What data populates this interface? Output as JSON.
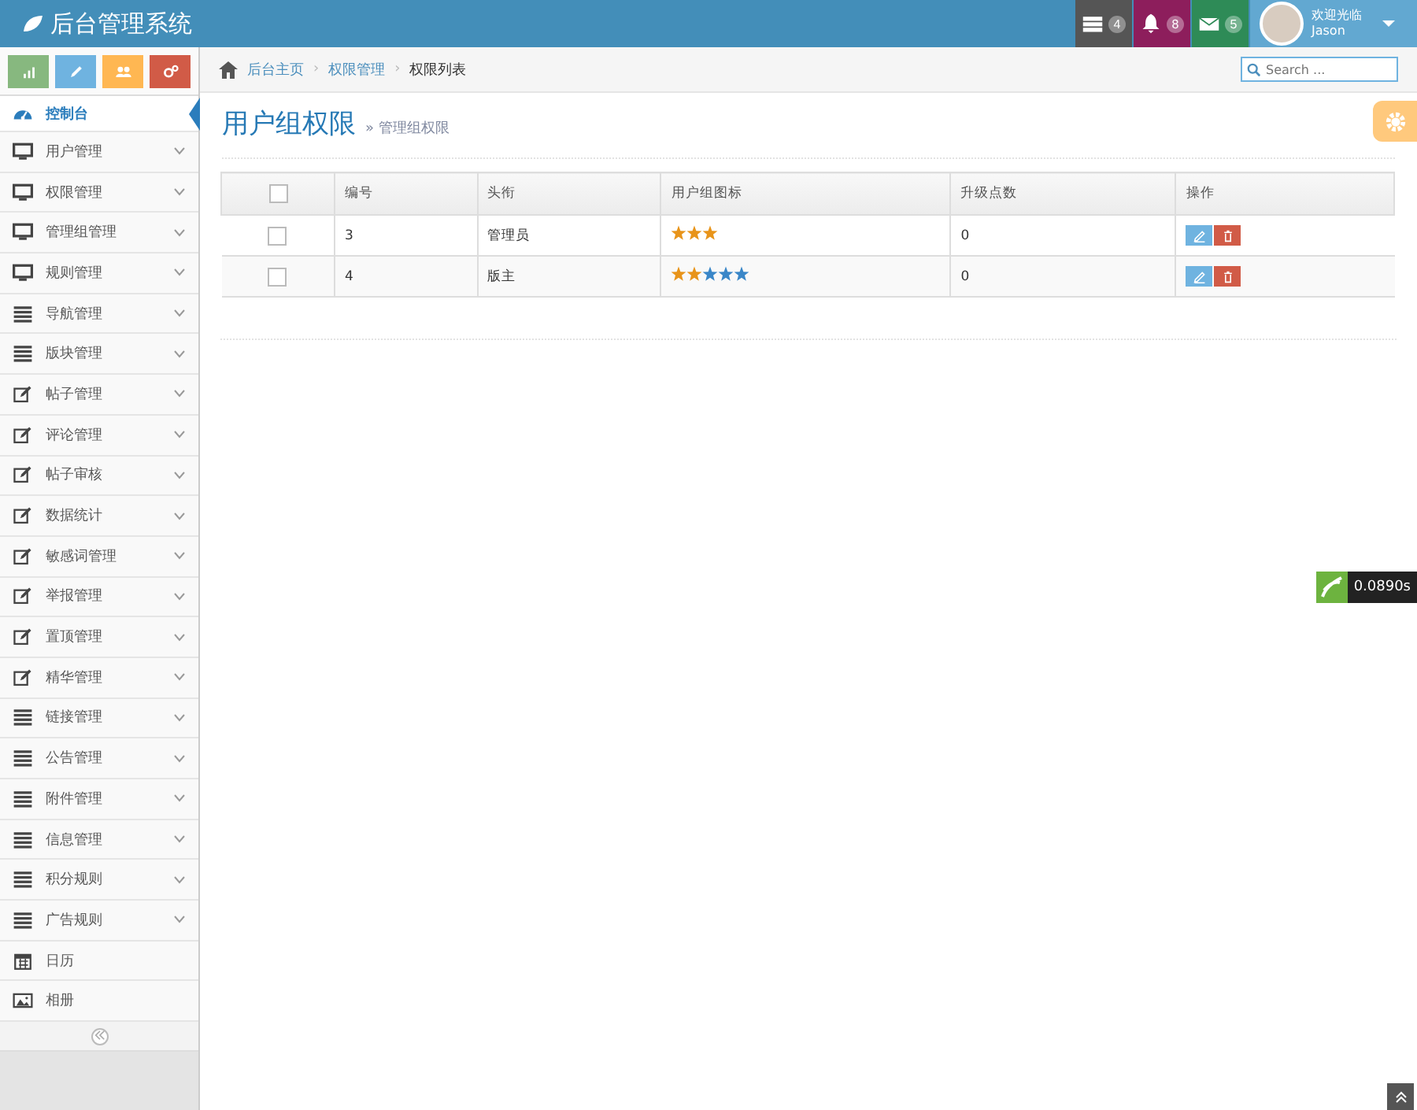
{
  "header": {
    "title": "后台管理系统",
    "badges": [
      {
        "kind": "tasks",
        "count": "4",
        "color": "#555555"
      },
      {
        "kind": "bell",
        "count": "8",
        "color": "#8d1e5c"
      },
      {
        "kind": "mail",
        "count": "5",
        "color": "#2e8b57"
      }
    ],
    "user": {
      "greeting": "欢迎光临",
      "name": "Jason"
    }
  },
  "shortcuts": [
    {
      "kind": "chart",
      "color": "#87b87f"
    },
    {
      "kind": "pencil",
      "color": "#6fb3e0"
    },
    {
      "kind": "users",
      "color": "#ffb752"
    },
    {
      "kind": "cogs",
      "color": "#d15b47"
    }
  ],
  "sidebar": {
    "items": [
      {
        "kind": "dashboard",
        "label": "控制台",
        "selected": true,
        "expandable": false
      },
      {
        "kind": "monitor",
        "label": "用户管理",
        "selected": false,
        "expandable": true
      },
      {
        "kind": "monitor",
        "label": "权限管理",
        "selected": false,
        "expandable": true
      },
      {
        "kind": "monitor",
        "label": "管理组管理",
        "selected": false,
        "expandable": true
      },
      {
        "kind": "monitor",
        "label": "规则管理",
        "selected": false,
        "expandable": true
      },
      {
        "kind": "list",
        "label": "导航管理",
        "selected": false,
        "expandable": true
      },
      {
        "kind": "list",
        "label": "版块管理",
        "selected": false,
        "expandable": true
      },
      {
        "kind": "edit",
        "label": "帖子管理",
        "selected": false,
        "expandable": true
      },
      {
        "kind": "edit",
        "label": "评论管理",
        "selected": false,
        "expandable": true
      },
      {
        "kind": "edit",
        "label": "帖子审核",
        "selected": false,
        "expandable": true
      },
      {
        "kind": "edit",
        "label": "数据统计",
        "selected": false,
        "expandable": true
      },
      {
        "kind": "edit",
        "label": "敏感词管理",
        "selected": false,
        "expandable": true
      },
      {
        "kind": "edit",
        "label": "举报管理",
        "selected": false,
        "expandable": true
      },
      {
        "kind": "edit",
        "label": "置顶管理",
        "selected": false,
        "expandable": true
      },
      {
        "kind": "edit",
        "label": "精华管理",
        "selected": false,
        "expandable": true
      },
      {
        "kind": "list",
        "label": "链接管理",
        "selected": false,
        "expandable": true
      },
      {
        "kind": "list",
        "label": "公告管理",
        "selected": false,
        "expandable": true
      },
      {
        "kind": "list",
        "label": "附件管理",
        "selected": false,
        "expandable": true
      },
      {
        "kind": "list",
        "label": "信息管理",
        "selected": false,
        "expandable": true
      },
      {
        "kind": "list",
        "label": "积分规则",
        "selected": false,
        "expandable": true
      },
      {
        "kind": "list",
        "label": "广告规则",
        "selected": false,
        "expandable": true
      },
      {
        "kind": "calendar",
        "label": "日历",
        "selected": false,
        "expandable": false
      },
      {
        "kind": "picture",
        "label": "相册",
        "selected": false,
        "expandable": false
      }
    ]
  },
  "breadcrumb": [
    "后台主页",
    "权限管理",
    "权限列表"
  ],
  "breadcrumb_separator": "›",
  "search": {
    "placeholder": "Search ..."
  },
  "page": {
    "title": "用户组权限",
    "subtitle_mark": "»",
    "subtitle": "管理组权限"
  },
  "table": {
    "select_all_checked": false,
    "columns": [
      "编号",
      "头衔",
      "用户组图标",
      "升级点数",
      "操作"
    ],
    "rows": [
      {
        "checked": false,
        "id": "3",
        "title": "管理员",
        "icon_stars": [
          {
            "color": "#e8941a"
          },
          {
            "color": "#e8941a"
          },
          {
            "color": "#e8941a"
          }
        ],
        "points": "0"
      },
      {
        "checked": false,
        "id": "4",
        "title": "版主",
        "icon_stars": [
          {
            "color": "#e8941a"
          },
          {
            "color": "#e8941a"
          },
          {
            "color": "#3a87c8"
          },
          {
            "color": "#3a87c8"
          },
          {
            "color": "#3a87c8"
          }
        ],
        "points": "0"
      }
    ]
  },
  "timer": "0.0890s"
}
